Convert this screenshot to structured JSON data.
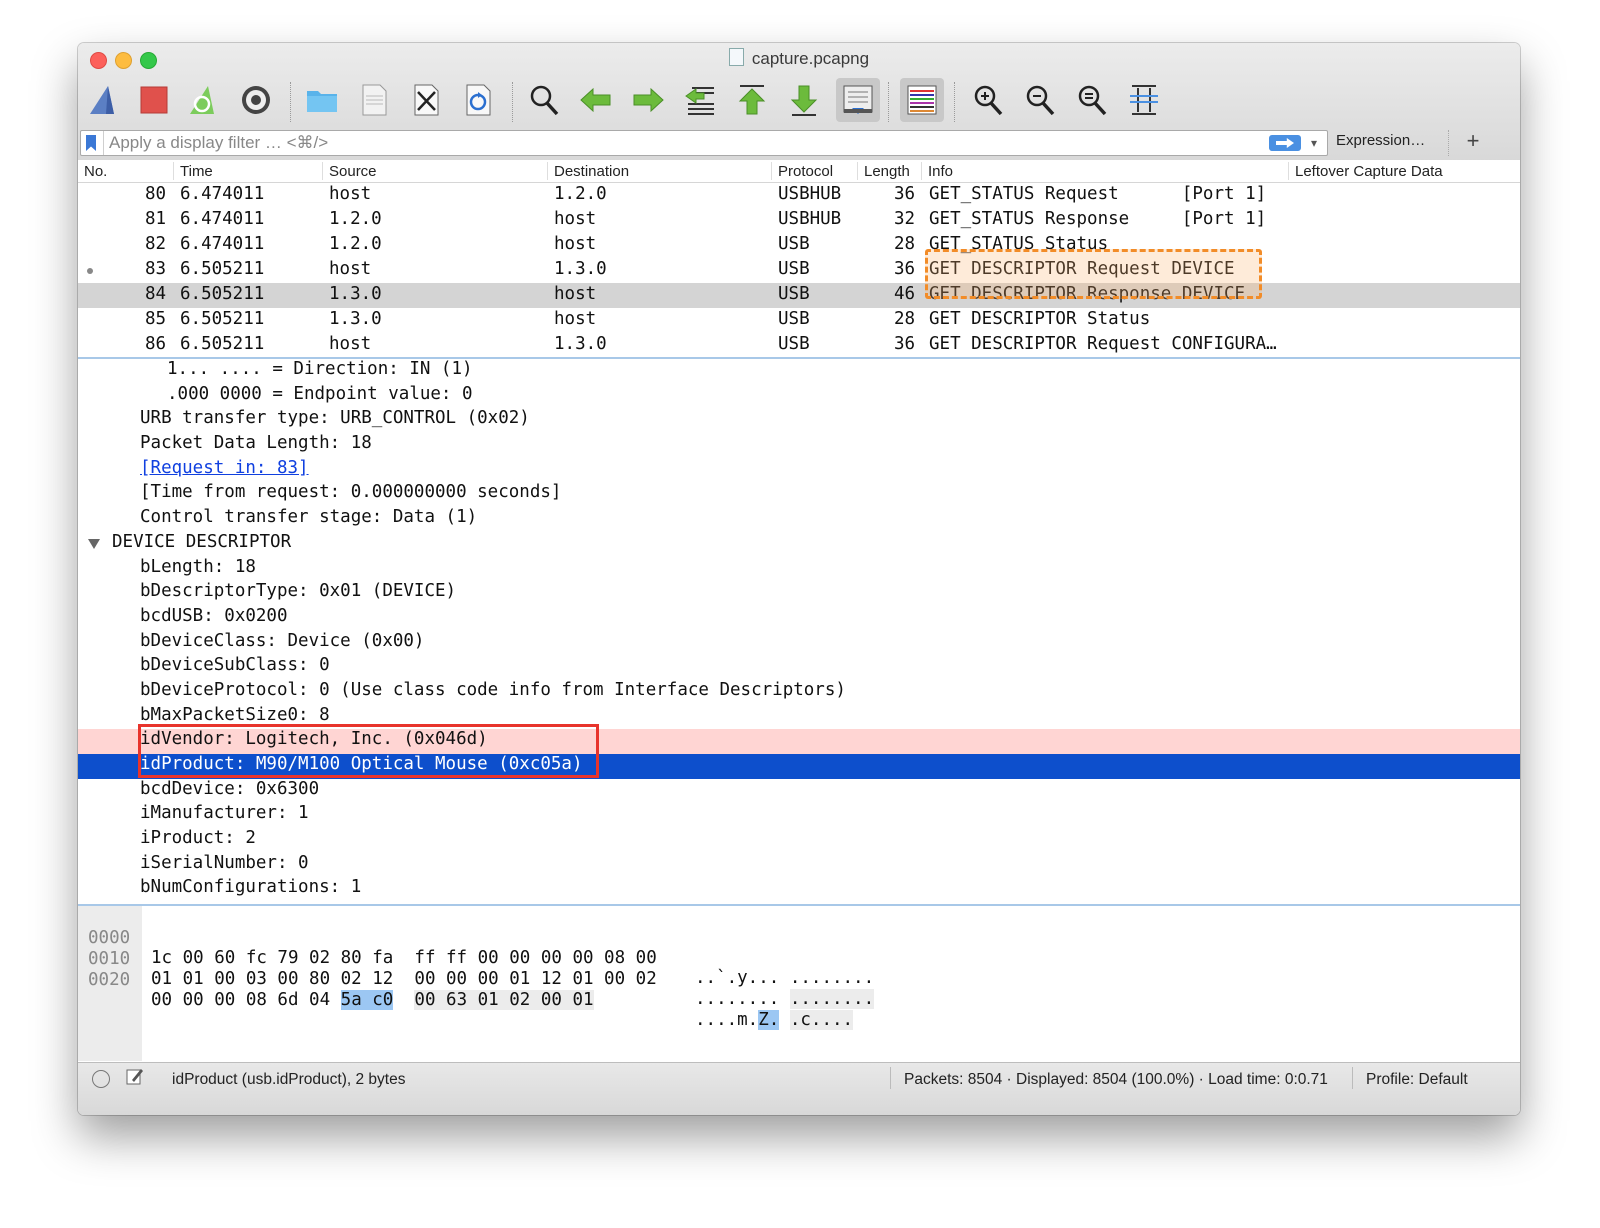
{
  "window": {
    "title": "capture.pcapng"
  },
  "filter": {
    "placeholder": "Apply a display filter … <⌘/>",
    "expression_label": "Expression…",
    "add_label": "+",
    "dropdown": "▾"
  },
  "packet_list": {
    "columns": [
      "No.",
      "Time",
      "Source",
      "Destination",
      "Protocol",
      "Length",
      "Info",
      "Leftover Capture Data"
    ],
    "rows": [
      {
        "no": "80",
        "time": "6.474011",
        "source": "host",
        "destination": "1.2.0",
        "protocol": "USBHUB",
        "length": "36",
        "info": "GET_STATUS Request      [Port 1]"
      },
      {
        "no": "81",
        "time": "6.474011",
        "source": "1.2.0",
        "destination": "host",
        "protocol": "USBHUB",
        "length": "32",
        "info": "GET_STATUS Response     [Port 1]"
      },
      {
        "no": "82",
        "time": "6.474011",
        "source": "1.2.0",
        "destination": "host",
        "protocol": "USB",
        "length": "28",
        "info": "GET_STATUS Status"
      },
      {
        "no": "83",
        "time": "6.505211",
        "source": "host",
        "destination": "1.3.0",
        "protocol": "USB",
        "length": "36",
        "info": "GET DESCRIPTOR Request DEVICE"
      },
      {
        "no": "84",
        "time": "6.505211",
        "source": "1.3.0",
        "destination": "host",
        "protocol": "USB",
        "length": "46",
        "info": "GET DESCRIPTOR Response DEVICE"
      },
      {
        "no": "85",
        "time": "6.505211",
        "source": "1.3.0",
        "destination": "host",
        "protocol": "USB",
        "length": "28",
        "info": "GET DESCRIPTOR Status"
      },
      {
        "no": "86",
        "time": "6.505211",
        "source": "host",
        "destination": "1.3.0",
        "protocol": "USB",
        "length": "36",
        "info": "GET DESCRIPTOR Request CONFIGURA…"
      }
    ]
  },
  "details": [
    "1... .... = Direction: IN (1)",
    ".000 0000 = Endpoint value: 0",
    "URB transfer type: URB_CONTROL (0x02)",
    "Packet Data Length: 18",
    "[Request in: 83]",
    "[Time from request: 0.000000000 seconds]",
    "Control transfer stage: Data (1)",
    "DEVICE DESCRIPTOR",
    "bLength: 18",
    "bDescriptorType: 0x01 (DEVICE)",
    "bcdUSB: 0x0200",
    "bDeviceClass: Device (0x00)",
    "bDeviceSubClass: 0",
    "bDeviceProtocol: 0 (Use class code info from Interface Descriptors)",
    "bMaxPacketSize0: 8",
    "idVendor: Logitech, Inc. (0x046d)",
    "idProduct: M90/M100 Optical Mouse (0xc05a)",
    "bcdDevice: 0x6300",
    "iManufacturer: 1",
    "iProduct: 2",
    "iSerialNumber: 0",
    "bNumConfigurations: 1"
  ],
  "hex": [
    {
      "offset": "0000",
      "bytes_a": "1c 00 60 fc 79 02 80 fa",
      "bytes_b": "ff ff 00 00 00 00 08 00",
      "ascii_a": "..`.y...",
      "ascii_b": "........"
    },
    {
      "offset": "0010",
      "bytes_a": "01 01 00 03 00 80 02 12",
      "bytes_b": "00 00 00 01 12 01 00 02",
      "ascii_a": "........",
      "ascii_b": "........"
    },
    {
      "offset": "0020",
      "bytes_a1": "00 00 00 08 6d 04 ",
      "bytes_hl": "5a c0",
      "bytes_b": "00 63 01 02 00 01",
      "ascii_a1": "....m.",
      "ascii_hl": "Z.",
      "ascii_b": ".c...."
    }
  ],
  "status": {
    "field": "idProduct (usb.idProduct), 2 bytes",
    "packets": "Packets: 8504 · Displayed: 8504 (100.0%) ·  Load time: 0:0.71",
    "profile": "Profile: Default"
  },
  "toolbar": [
    "start-capture-icon",
    "stop-capture-icon",
    "restart-capture-icon",
    "capture-options-icon",
    "open-file-icon",
    "save-file-icon",
    "close-file-icon",
    "reload-file-icon",
    "find-packet-icon",
    "go-back-icon",
    "go-forward-icon",
    "go-to-packet-icon",
    "go-first-icon",
    "go-last-icon",
    "autoscroll-icon",
    "colorize-icon",
    "zoom-in-icon",
    "zoom-out-icon",
    "zoom-reset-icon",
    "resize-columns-icon"
  ],
  "colors": {
    "selection": "#0d4fcc",
    "highlight_orange": "#f28c28",
    "highlight_red": "#e8342c",
    "hex_highlight": "#9cc7f3"
  }
}
